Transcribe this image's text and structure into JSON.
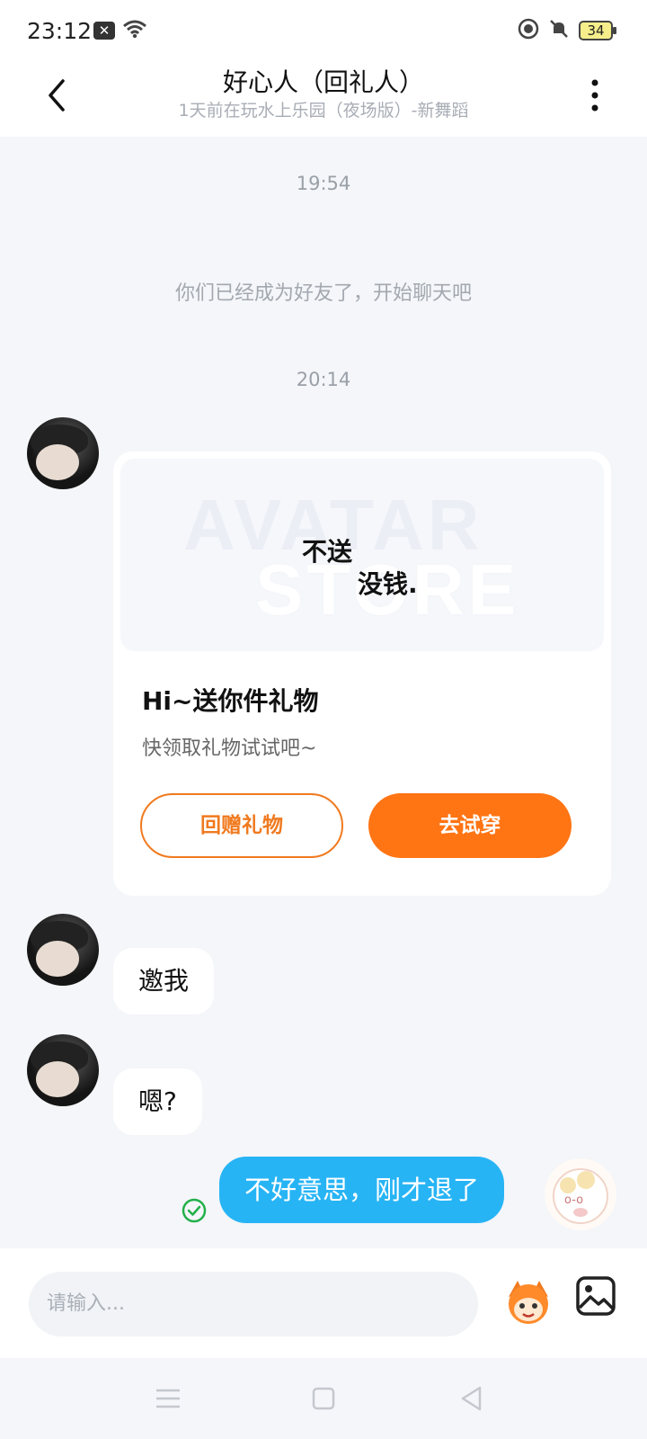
{
  "status_bar": {
    "time": "23:12",
    "notification_icon": "x-notification-icon",
    "battery": "34"
  },
  "header": {
    "title": "好心人（回礼人）",
    "subtitle": "1天前在玩水上乐园（夜场版）-新舞蹈"
  },
  "chat": {
    "time1": "19:54",
    "system_message": "你们已经成为好友了，开始聊天吧",
    "time2": "20:14",
    "gift_card": {
      "image_line1": "不送",
      "image_line2": "没钱.",
      "watermark_top": "AVATAR",
      "watermark_bottom": "STORE",
      "title": "Hi~送你件礼物",
      "subtitle": "快领取礼物试试吧~",
      "return_gift_label": "回赠礼物",
      "try_on_label": "去试穿"
    },
    "messages": [
      {
        "from": "other",
        "text": "邀我"
      },
      {
        "from": "other",
        "text": "嗯?"
      },
      {
        "from": "me",
        "text": "不好意思，刚才退了"
      }
    ]
  },
  "input": {
    "placeholder": "请输入..."
  },
  "colors": {
    "accent_orange": "#ff7413",
    "bubble_blue": "#27b4f5",
    "background": "#f4f6f9",
    "sent_check": "#22b04a"
  }
}
